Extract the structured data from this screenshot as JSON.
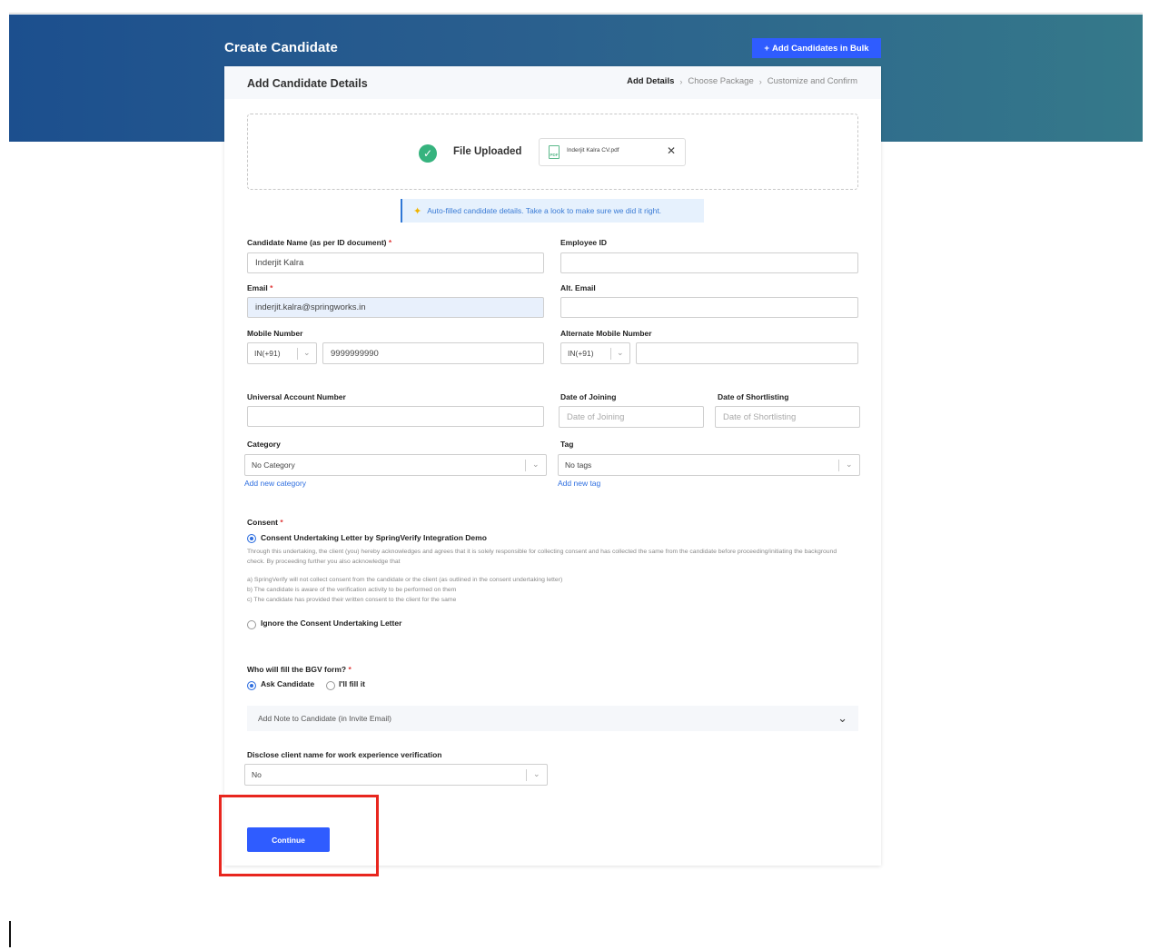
{
  "header": {
    "title": "Create Candidate",
    "bulk_button": "Add Candidates in Bulk",
    "bulk_plus": "+"
  },
  "card": {
    "title": "Add Candidate Details",
    "steps": [
      "Add Details",
      "Choose Package",
      "Customize and Confirm"
    ]
  },
  "upload": {
    "status": "File Uploaded",
    "file_name": "Inderjit Kalra CV.pdf",
    "pdf_label": "PDF"
  },
  "autofill_notice": "Auto-filled candidate details. Take a look to make sure we did it right.",
  "fields": {
    "name_label": "Candidate Name (as per ID document)",
    "name_value": "Inderjit Kalra",
    "employee_id_label": "Employee ID",
    "email_label": "Email",
    "email_value": "inderjit.kalra@springworks.in",
    "alt_email_label": "Alt. Email",
    "mobile_label": "Mobile Number",
    "mobile_code": "IN(+91)",
    "mobile_value": "9999999990",
    "alt_mobile_label": "Alternate Mobile Number",
    "alt_mobile_code": "IN(+91)",
    "uan_label": "Universal Account Number",
    "doj_label": "Date of Joining",
    "doj_placeholder": "Date of Joining",
    "dos_label": "Date of Shortlisting",
    "dos_placeholder": "Date of Shortlisting",
    "category_label": "Category",
    "category_value": "No Category",
    "add_category": "Add new category",
    "tag_label": "Tag",
    "tag_value": "No tags",
    "add_tag": "Add new tag",
    "required_mark": "*"
  },
  "consent": {
    "label": "Consent",
    "option1": "Consent Undertaking Letter by SpringVerify Integration Demo",
    "desc": "Through this undertaking, the client (you) hereby acknowledges and agrees that it is solely responsible for collecting consent and has collected the same from the candidate before proceeding/initiating the background check. By proceeding further you also acknowledge that",
    "points": [
      "a) SpringVerify will not collect consent from the candidate or the client (as outlined in the consent undertaking letter)",
      "b) The candidate is aware of the verification activity to be performed on them",
      "c) The candidate has provided their written consent to the client for the same"
    ],
    "option2": "Ignore the Consent Undertaking Letter"
  },
  "bgv": {
    "label": "Who will fill the BGV form?",
    "option1": "Ask Candidate",
    "option2": "I'll fill it"
  },
  "note": {
    "label": "Add Note to Candidate (in Invite Email)"
  },
  "disclose": {
    "label": "Disclose client name for work experience verification",
    "value": "No"
  },
  "actions": {
    "continue": "Continue"
  }
}
